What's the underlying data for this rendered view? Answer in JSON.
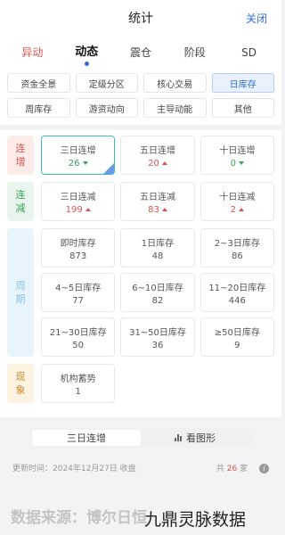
{
  "header": {
    "title": "统计",
    "close_label": "关闭"
  },
  "tabs": [
    {
      "label": "异动"
    },
    {
      "label": "动态"
    },
    {
      "label": "震仓"
    },
    {
      "label": "阶段"
    },
    {
      "label": "SD"
    }
  ],
  "filters": [
    {
      "label": "资金全景"
    },
    {
      "label": "定级分区"
    },
    {
      "label": "核心交易"
    },
    {
      "label": "日库存"
    },
    {
      "label": "周库存"
    },
    {
      "label": "游资动向"
    },
    {
      "label": "主导动能"
    },
    {
      "label": "其他"
    }
  ],
  "groups": [
    {
      "label": "连增",
      "cells": [
        {
          "title": "三日连增",
          "value": "26",
          "trend": "down"
        },
        {
          "title": "五日连增",
          "value": "20",
          "trend": "up"
        },
        {
          "title": "十日连增",
          "value": "0",
          "trend": "down"
        }
      ]
    },
    {
      "label": "连减",
      "cells": [
        {
          "title": "三日连减",
          "value": "199",
          "trend": "up"
        },
        {
          "title": "五日连减",
          "value": "83",
          "trend": "up"
        },
        {
          "title": "十日连减",
          "value": "2",
          "trend": "up"
        }
      ]
    },
    {
      "label": "周期",
      "cells": [
        {
          "title": "即时库存",
          "value": "873"
        },
        {
          "title": "1日库存",
          "value": "48"
        },
        {
          "title": "2~3日库存",
          "value": "86"
        },
        {
          "title": "4~5日库存",
          "value": "77"
        },
        {
          "title": "6~10日库存",
          "value": "82"
        },
        {
          "title": "11~20日库存",
          "value": "446"
        },
        {
          "title": "21~30日库存",
          "value": "50"
        },
        {
          "title": "31~50日库存",
          "value": "36"
        },
        {
          "title": "≥50日库存",
          "value": "9"
        }
      ]
    },
    {
      "label": "现象",
      "cells": [
        {
          "title": "机构蓄势",
          "value": "1"
        }
      ]
    }
  ],
  "switch": {
    "left": "三日连增",
    "right": "看图形"
  },
  "footer": {
    "updated": "更新时间：2024年12月27日 收盘",
    "count_prefix": "共",
    "count": "26",
    "count_suffix": "家"
  },
  "watermark": {
    "source": "数据来源：博尔日恒",
    "brand": "九鼎灵脉数据"
  },
  "colors": {
    "up": "#d9534f",
    "down": "#3aa35a",
    "accent": "#2f6fd6"
  }
}
